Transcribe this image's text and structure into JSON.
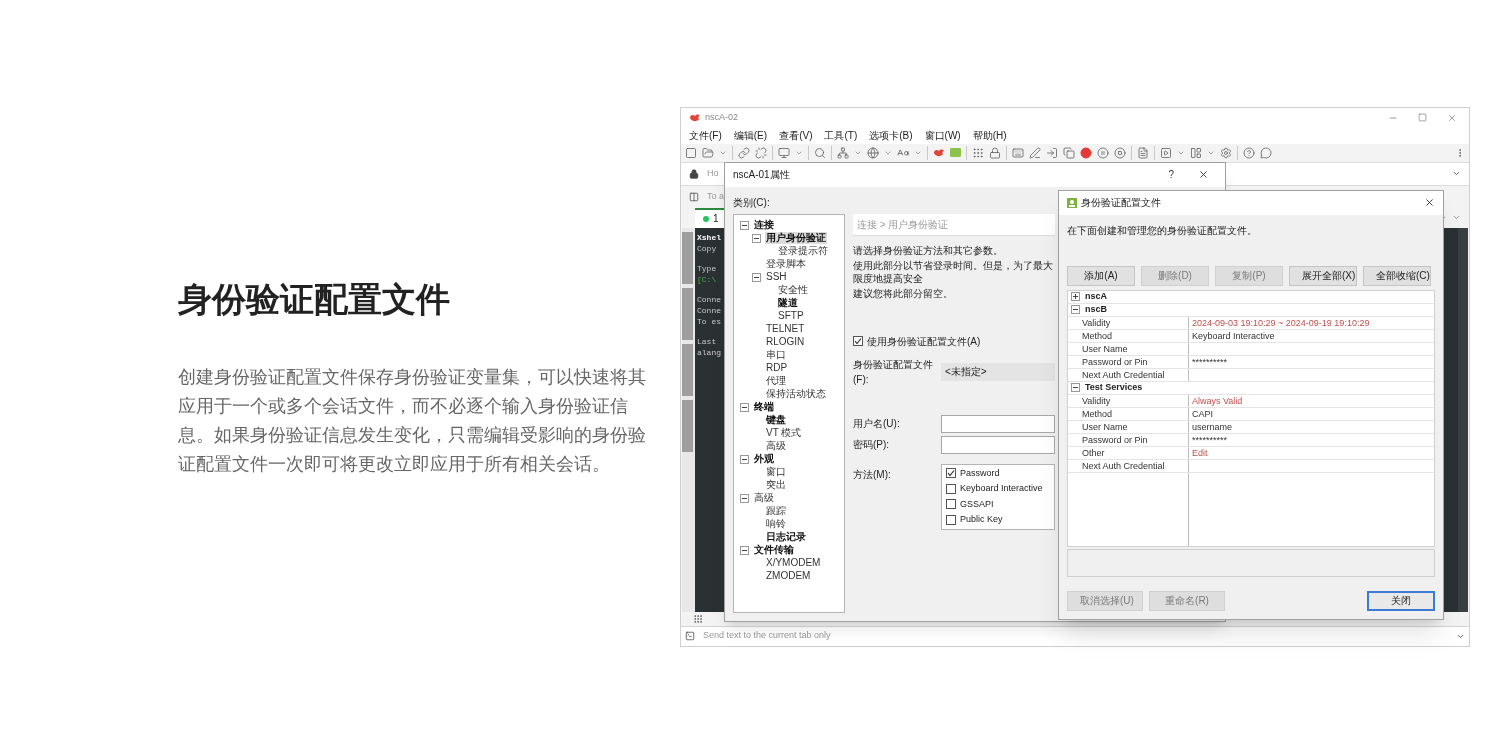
{
  "intro": {
    "title": "身份验证配置文件",
    "body": "创建身份验证配置文件保存身份验证变量集，可以快速将其应用于一个或多个会话文件，而不必逐个输入身份验证信息。如果身份验证信息发生变化，只需编辑受影响的身份验证配置文件一次即可将更改立即应用于所有相关会话。"
  },
  "app_window": {
    "title": "nscA-02",
    "menu": [
      "文件(F)",
      "编辑(E)",
      "查看(V)",
      "工具(T)",
      "选项卡(B)",
      "窗口(W)",
      "帮助(H)"
    ],
    "address_placeholder": "Ho",
    "hint_bar": "To a",
    "tabs": [
      {
        "label": "1",
        "selected": true,
        "color": "#22c55e"
      }
    ],
    "terminal_blocks": [
      [
        {
          "text": "Xshel",
          "kind": "banner"
        },
        {
          "text": "Copy",
          "kind": "output"
        }
      ],
      [
        {
          "text": "Type",
          "kind": "output"
        },
        {
          "text": "[C:\\",
          "kind": "prompt"
        }
      ],
      [
        {
          "text": "Conne",
          "kind": "output"
        },
        {
          "text": "Conne",
          "kind": "output"
        },
        {
          "text": "To es",
          "kind": "output"
        }
      ],
      [
        {
          "text": "Last",
          "kind": "output"
        },
        {
          "text": "alang",
          "kind": "output"
        }
      ]
    ],
    "send_bar_placeholder": "Send text to the current tab only"
  },
  "properties_dialog": {
    "title": "nscA-01属性",
    "help": "?",
    "category_label": "类别(C):",
    "tree": [
      {
        "label": "连接",
        "modified": true,
        "selected": false,
        "expanded": true,
        "children": [
          {
            "label": "用户身份验证",
            "modified": true,
            "selected": true,
            "expanded": true,
            "children": [
              {
                "label": "登录提示符",
                "modified": false,
                "selected": false
              }
            ]
          },
          {
            "label": "登录脚本",
            "modified": false,
            "selected": false
          },
          {
            "label": "SSH",
            "modified": false,
            "selected": false,
            "expanded": true,
            "children": [
              {
                "label": "安全性",
                "modified": false,
                "selected": false
              },
              {
                "label": "隧道",
                "modified": true,
                "selected": false
              },
              {
                "label": "SFTP",
                "modified": false,
                "selected": false
              }
            ]
          },
          {
            "label": "TELNET",
            "modified": false,
            "selected": false
          },
          {
            "label": "RLOGIN",
            "modified": false,
            "selected": false
          },
          {
            "label": "串口",
            "modified": false,
            "selected": false
          },
          {
            "label": "RDP",
            "modified": false,
            "selected": false
          },
          {
            "label": "代理",
            "modified": false,
            "selected": false
          },
          {
            "label": "保持活动状态",
            "modified": false,
            "selected": false
          }
        ]
      },
      {
        "label": "终端",
        "modified": true,
        "selected": false,
        "expanded": true,
        "children": [
          {
            "label": "键盘",
            "modified": true,
            "selected": false
          },
          {
            "label": "VT 模式",
            "modified": false,
            "selected": false
          },
          {
            "label": "高级",
            "modified": false,
            "selected": false
          }
        ]
      },
      {
        "label": "外观",
        "modified": true,
        "selected": false,
        "expanded": true,
        "children": [
          {
            "label": "窗口",
            "modified": false,
            "selected": false
          },
          {
            "label": "突出",
            "modified": false,
            "selected": false
          }
        ]
      },
      {
        "label": "高级",
        "modified": false,
        "selected": false,
        "expanded": true,
        "children": [
          {
            "label": "跟踪",
            "modified": false,
            "selected": false
          },
          {
            "label": "响铃",
            "modified": false,
            "selected": false
          },
          {
            "label": "日志记录",
            "modified": true,
            "selected": false
          }
        ]
      },
      {
        "label": "文件传输",
        "modified": true,
        "selected": false,
        "expanded": true,
        "children": [
          {
            "label": "X/YMODEM",
            "modified": false,
            "selected": false
          },
          {
            "label": "ZMODEM",
            "modified": false,
            "selected": false
          }
        ]
      }
    ],
    "breadcrumb": "连接 > 用户身份验证",
    "description": [
      "请选择身份验证方法和其它参数。",
      "使用此部分以节省登录时间。但是，为了最大限度地提高安全",
      "建议您将此部分留空。"
    ],
    "use_profile": {
      "label": "使用身份验证配置文件(A)",
      "checked": true
    },
    "profile": {
      "label": "身份验证配置文件(F):",
      "value": "<未指定>"
    },
    "username": {
      "label": "用户名(U):"
    },
    "password": {
      "label": "密码(P):"
    },
    "method": {
      "label": "方法(M):",
      "options": [
        {
          "label": "Password",
          "checked": true
        },
        {
          "label": "Keyboard Interactive",
          "checked": false
        },
        {
          "label": "GSSAPI",
          "checked": false
        },
        {
          "label": "Public Key",
          "checked": false
        }
      ]
    }
  },
  "profile_dialog": {
    "title": "身份验证配置文件",
    "description": "在下面创建和管理您的身份验证配置文件。",
    "actions": [
      {
        "label": "添加(A)",
        "disabled": false
      },
      {
        "label": "删除(D)",
        "disabled": true
      },
      {
        "label": "复制(P)",
        "disabled": true
      },
      {
        "label": "展开全部(X)",
        "disabled": false
      },
      {
        "label": "全部收缩(C)",
        "disabled": false
      }
    ],
    "groups": [
      {
        "name": "nscA",
        "expanded": false
      },
      {
        "name": "nscB",
        "expanded": true,
        "rows": [
          {
            "key": "Validity",
            "value": "2024-09-03 19:10:29 ~ 2024-09-19 19:10:29",
            "alert": true
          },
          {
            "key": "Method",
            "value": "Keyboard Interactive"
          },
          {
            "key": "User Name"
          },
          {
            "key": "Password or Pin",
            "value": "**********"
          },
          {
            "key": "Next Auth Credential"
          }
        ]
      },
      {
        "name": "Test Services",
        "expanded": true,
        "rows": [
          {
            "key": "Validity",
            "value": "Always Valid",
            "alert": true
          },
          {
            "key": "Method",
            "value": "CAPI"
          },
          {
            "key": "User Name",
            "value": "username"
          },
          {
            "key": "Password or Pin",
            "value": "**********"
          },
          {
            "key": "Other",
            "value": "Edit",
            "alert": true
          },
          {
            "key": "Next Auth Credential"
          }
        ]
      }
    ],
    "footer_buttons": [
      {
        "label": "取消选择(U)",
        "disabled": true,
        "default": false
      },
      {
        "label": "重命名(R)",
        "disabled": true,
        "default": false
      },
      {
        "label": "关闭",
        "disabled": false,
        "default": true
      }
    ]
  }
}
